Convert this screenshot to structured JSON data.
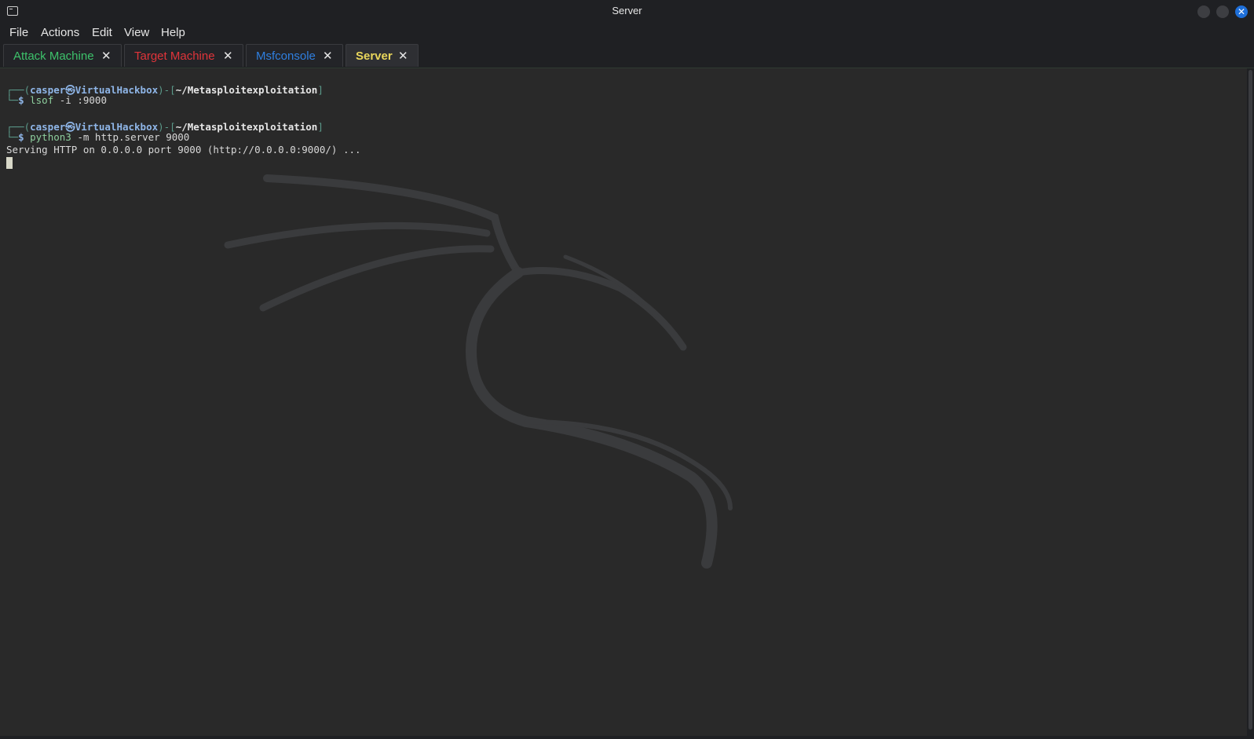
{
  "window": {
    "title": "Server"
  },
  "menu": [
    "File",
    "Actions",
    "Edit",
    "View",
    "Help"
  ],
  "tabs": [
    {
      "label": "Attack Machine",
      "color": "#3dc26b",
      "active": false
    },
    {
      "label": "Target Machine",
      "color": "#e0343a",
      "active": false
    },
    {
      "label": "Msfconsole",
      "color": "#2f7fe0",
      "active": false
    },
    {
      "label": "Server",
      "color": "#e9d65b",
      "active": true
    }
  ],
  "tab_close_glyph": "✕",
  "terminal": {
    "prompt1": {
      "frame_top": "┌──(",
      "user": "casper㉿VirtualHackbox",
      "mid": ")-[",
      "dir": "~/Metasploitexploitation",
      "end": "]",
      "frame_bottom": "└─",
      "sigil": "$ ",
      "cmd": "lsof",
      "args": " -i :9000"
    },
    "prompt2": {
      "frame_top": "┌──(",
      "user": "casper㉿VirtualHackbox",
      "mid": ")-[",
      "dir": "~/Metasploitexploitation",
      "end": "]",
      "frame_bottom": "└─",
      "sigil": "$ ",
      "cmd": "python3",
      "args": " -m http.server 9000"
    },
    "output": "Serving HTTP on 0.0.0.0 port 9000 (http://0.0.0.0:9000/) ..."
  },
  "icons": {
    "app": "terminal-icon",
    "close": "close-icon",
    "background": "kali-dragon-logo"
  }
}
